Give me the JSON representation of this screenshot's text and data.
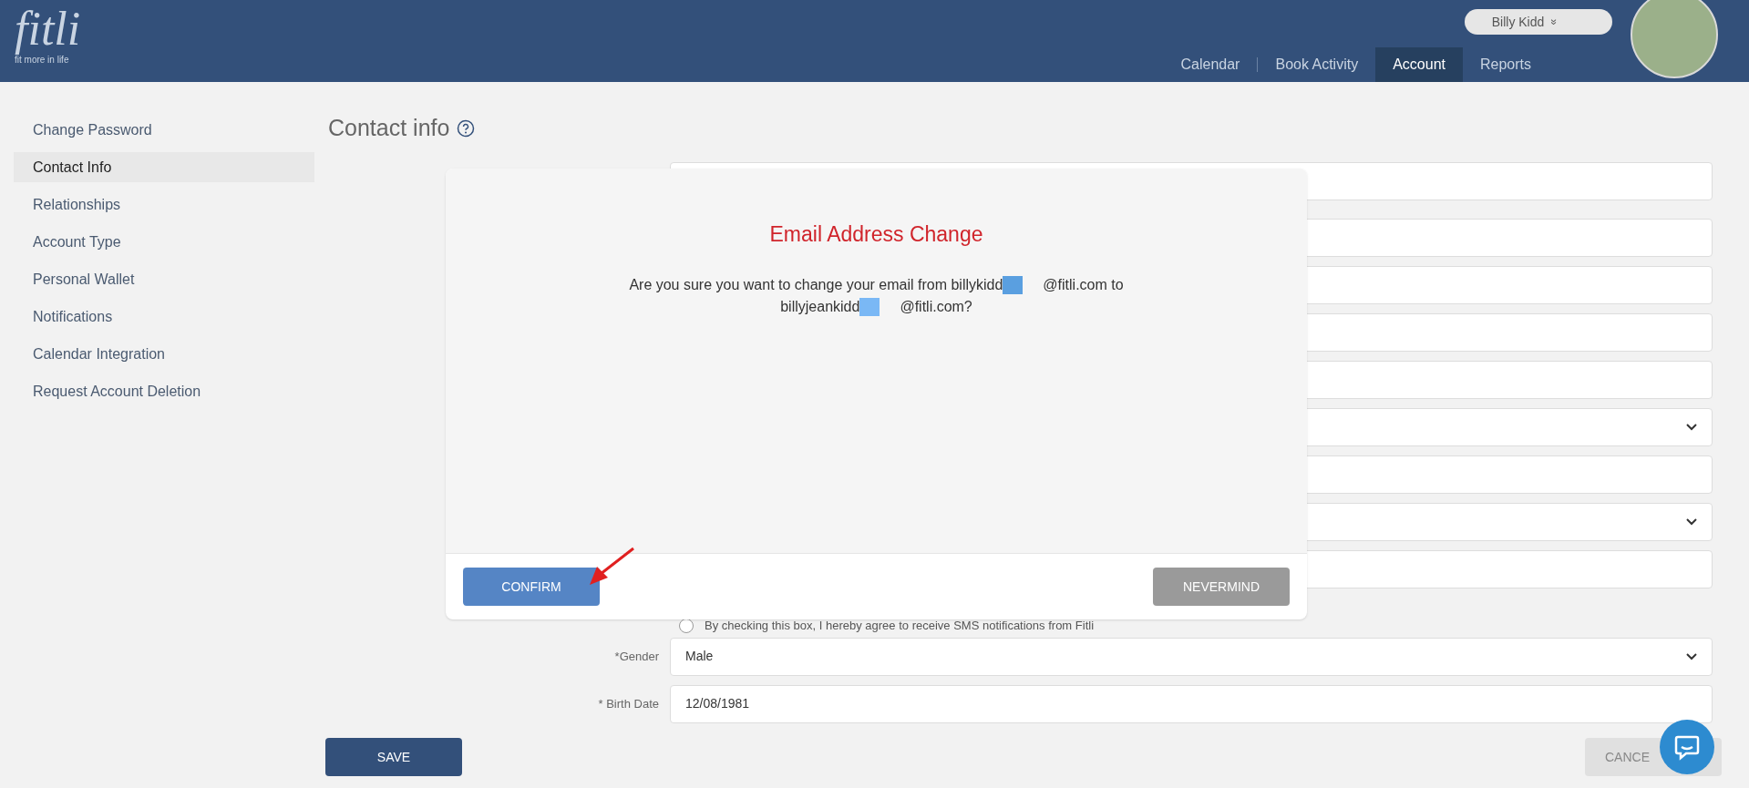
{
  "header": {
    "logo": "fitli",
    "tagline": "fit more in life",
    "user": {
      "name": "Billy Kidd",
      "caret": "»"
    },
    "nav": [
      {
        "label": "Calendar",
        "selected": false
      },
      {
        "label": "Book Activity",
        "selected": false
      },
      {
        "label": "Account",
        "selected": true
      },
      {
        "label": "Reports",
        "selected": false
      }
    ]
  },
  "sidebar": {
    "items": [
      {
        "label": "Change Password",
        "selected": false
      },
      {
        "label": "Contact Info",
        "selected": true
      },
      {
        "label": "Relationships",
        "selected": false
      },
      {
        "label": "Account Type",
        "selected": false
      },
      {
        "label": "Personal Wallet",
        "selected": false
      },
      {
        "label": "Notifications",
        "selected": false
      },
      {
        "label": "Calendar Integration",
        "selected": false
      },
      {
        "label": "Request Account Deletion",
        "selected": false
      }
    ]
  },
  "page": {
    "title": "Contact info",
    "fields": [
      {
        "kind": "text"
      },
      {
        "kind": "text"
      },
      {
        "kind": "text"
      },
      {
        "kind": "text"
      },
      {
        "kind": "text"
      },
      {
        "kind": "select"
      },
      {
        "kind": "text"
      },
      {
        "kind": "select"
      },
      {
        "kind": "text"
      },
      {
        "kind": "checkbox",
        "text": "By checking this box, I hereby agree to receive SMS notifications from Fitli",
        "checked": false
      },
      {
        "kind": "select",
        "label": "*Gender",
        "value": "Male"
      },
      {
        "kind": "text",
        "label": "* Birth Date",
        "value": "12/08/1981"
      }
    ],
    "buttons": [
      {
        "label": "SAVE",
        "kind": "primary"
      },
      {
        "label": "CANCE",
        "kind": "secondary"
      }
    ]
  },
  "dialog": {
    "title": "Email Address Change",
    "message": [
      "Are you sure you want to change your email from billykidd",
      "@fitli.com to billyjeankidd",
      "@fitli.com?"
    ],
    "buttons": [
      {
        "label": "CONFIRM",
        "kind": "primary"
      },
      {
        "label": "NEVERMIND",
        "kind": "secondary"
      }
    ]
  }
}
